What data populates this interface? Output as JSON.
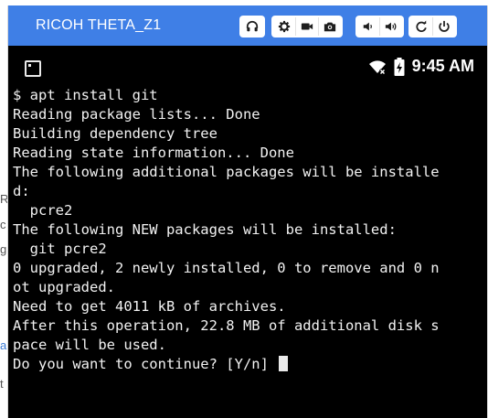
{
  "window": {
    "title": "RICOH THETA_Z1",
    "accent_color": "#3f7fe6"
  },
  "toolbar": {
    "groups": [
      [
        "headphones-icon"
      ],
      [
        "gear-icon",
        "video-camera-icon",
        "camera-icon"
      ],
      [
        "volume-down-icon",
        "volume-up-icon"
      ],
      [
        "rotate-icon",
        "power-icon"
      ]
    ]
  },
  "statusbar": {
    "time": "9:45 AM",
    "icons": [
      "app-icon",
      "wifi-off-icon",
      "battery-charging-icon"
    ]
  },
  "terminal": {
    "lines": [
      "$ apt install git",
      "Reading package lists... Done",
      "Building dependency tree",
      "Reading state information... Done",
      "The following additional packages will be installe",
      "d:",
      "  pcre2",
      "The following NEW packages will be installed:",
      "  git pcre2",
      "0 upgraded, 2 newly installed, 0 to remove and 0 n",
      "ot upgraded.",
      "Need to get 4011 kB of archives.",
      "After this operation, 22.8 MB of additional disk s",
      "pace will be used.",
      "Do you want to continue? [Y/n] "
    ]
  },
  "background_page": {
    "fragments": [
      "R",
      "c",
      "g",
      "a",
      "t"
    ]
  }
}
